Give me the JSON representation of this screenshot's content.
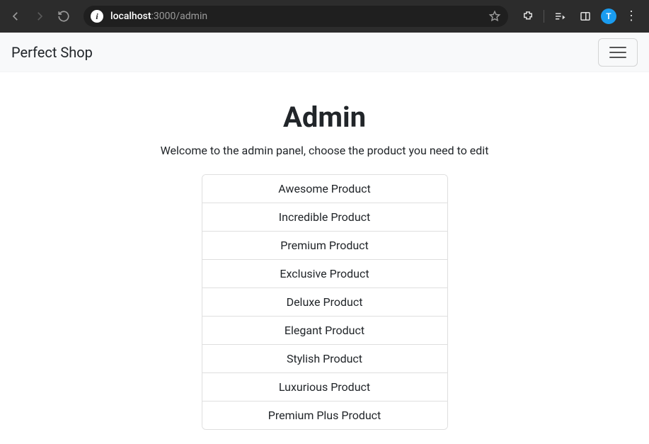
{
  "browser": {
    "url_host": "localhost",
    "url_port_path": ":3000/admin",
    "avatar_letter": "T"
  },
  "navbar": {
    "brand": "Perfect Shop"
  },
  "page": {
    "title": "Admin",
    "subtitle": "Welcome to the admin panel, choose the product you need to edit"
  },
  "products": [
    {
      "name": "Awesome Product"
    },
    {
      "name": "Incredible Product"
    },
    {
      "name": "Premium Product"
    },
    {
      "name": "Exclusive Product"
    },
    {
      "name": "Deluxe Product"
    },
    {
      "name": "Elegant Product"
    },
    {
      "name": "Stylish Product"
    },
    {
      "name": "Luxurious Product"
    },
    {
      "name": "Premium Plus Product"
    }
  ]
}
